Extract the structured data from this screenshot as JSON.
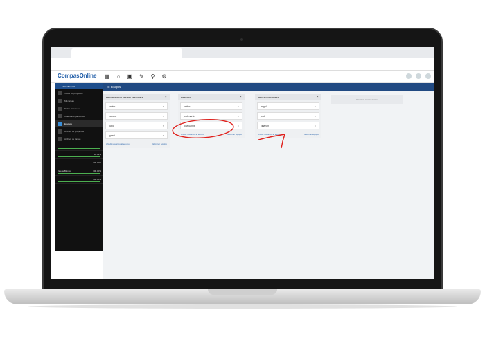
{
  "browser": {
    "tab_title": "",
    "bookmarks": [
      "",
      "",
      "",
      "",
      "",
      "",
      "",
      "",
      ""
    ]
  },
  "app": {
    "logo": "CompasOnline",
    "header_title": "Equipos"
  },
  "sidebar": {
    "head": "PROYECTOS",
    "items": [
      {
        "label": "Todos los proyectos"
      },
      {
        "label": "Mis tareas"
      },
      {
        "label": "Todas las tareas"
      },
      {
        "label": "Calendario planificado"
      },
      {
        "label": "Equipos"
      },
      {
        "label": "Archivo de proyectos"
      },
      {
        "label": "Archivo de tareas"
      }
    ],
    "projects": [
      {
        "name": "",
        "pct": ""
      },
      {
        "name": "",
        "pct": "99.91%"
      },
      {
        "name": "",
        "pct": "100.00%"
      },
      {
        "name": "Tareas Blanco",
        "pct": "100.00%"
      },
      {
        "name": "",
        "pct": "100.00%"
      }
    ]
  },
  "teams": [
    {
      "title": "PROGRAMACIO MULTIPLATAFORMA",
      "members": [
        "xavier",
        "carrera",
        "rubio",
        "ignasi"
      ],
      "add_label": "Añadir usuarios al equipo",
      "delete_label": "Eliminar equipo"
    },
    {
      "title": "SISTEMES",
      "members": [
        "tavitor",
        "jordimartin",
        "josejuanbe"
      ],
      "add_label": "Añadir usuarios al equipo",
      "delete_label": "Eliminar equipo"
    },
    {
      "title": "PROGRAMACIO WEB",
      "members": [
        "angel",
        "jordi",
        "clrianch"
      ],
      "add_label": "Añadir usuarios al equipo",
      "delete_label": "Eliminar equipo"
    }
  ],
  "create_team_label": "Crear un equipo nuevo",
  "colors": {
    "header": "#214a82",
    "sidebar": "#111111",
    "accent": "#3b8fd8",
    "annotation": "#e0201c"
  }
}
